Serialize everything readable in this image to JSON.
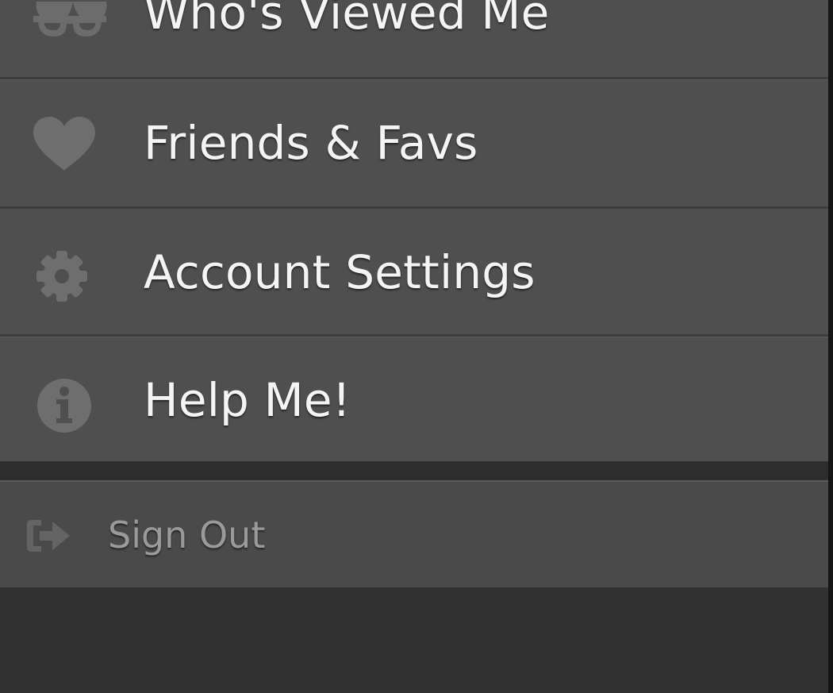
{
  "menu": {
    "items": [
      {
        "label": "Who's Viewed Me",
        "icon": "glasses-icon"
      },
      {
        "label": "Friends & Favs",
        "icon": "heart-icon"
      },
      {
        "label": "Account Settings",
        "icon": "gear-icon"
      },
      {
        "label": "Help Me!",
        "icon": "info-icon"
      }
    ],
    "sign_out": {
      "label": "Sign Out",
      "icon": "sign-out-icon"
    }
  },
  "colors": {
    "background": "#333333",
    "item_background": "#4f4f4f",
    "item_text": "#f4f4f4",
    "icon": "#6e6e6e",
    "sign_out_text": "#9a9a9a"
  }
}
